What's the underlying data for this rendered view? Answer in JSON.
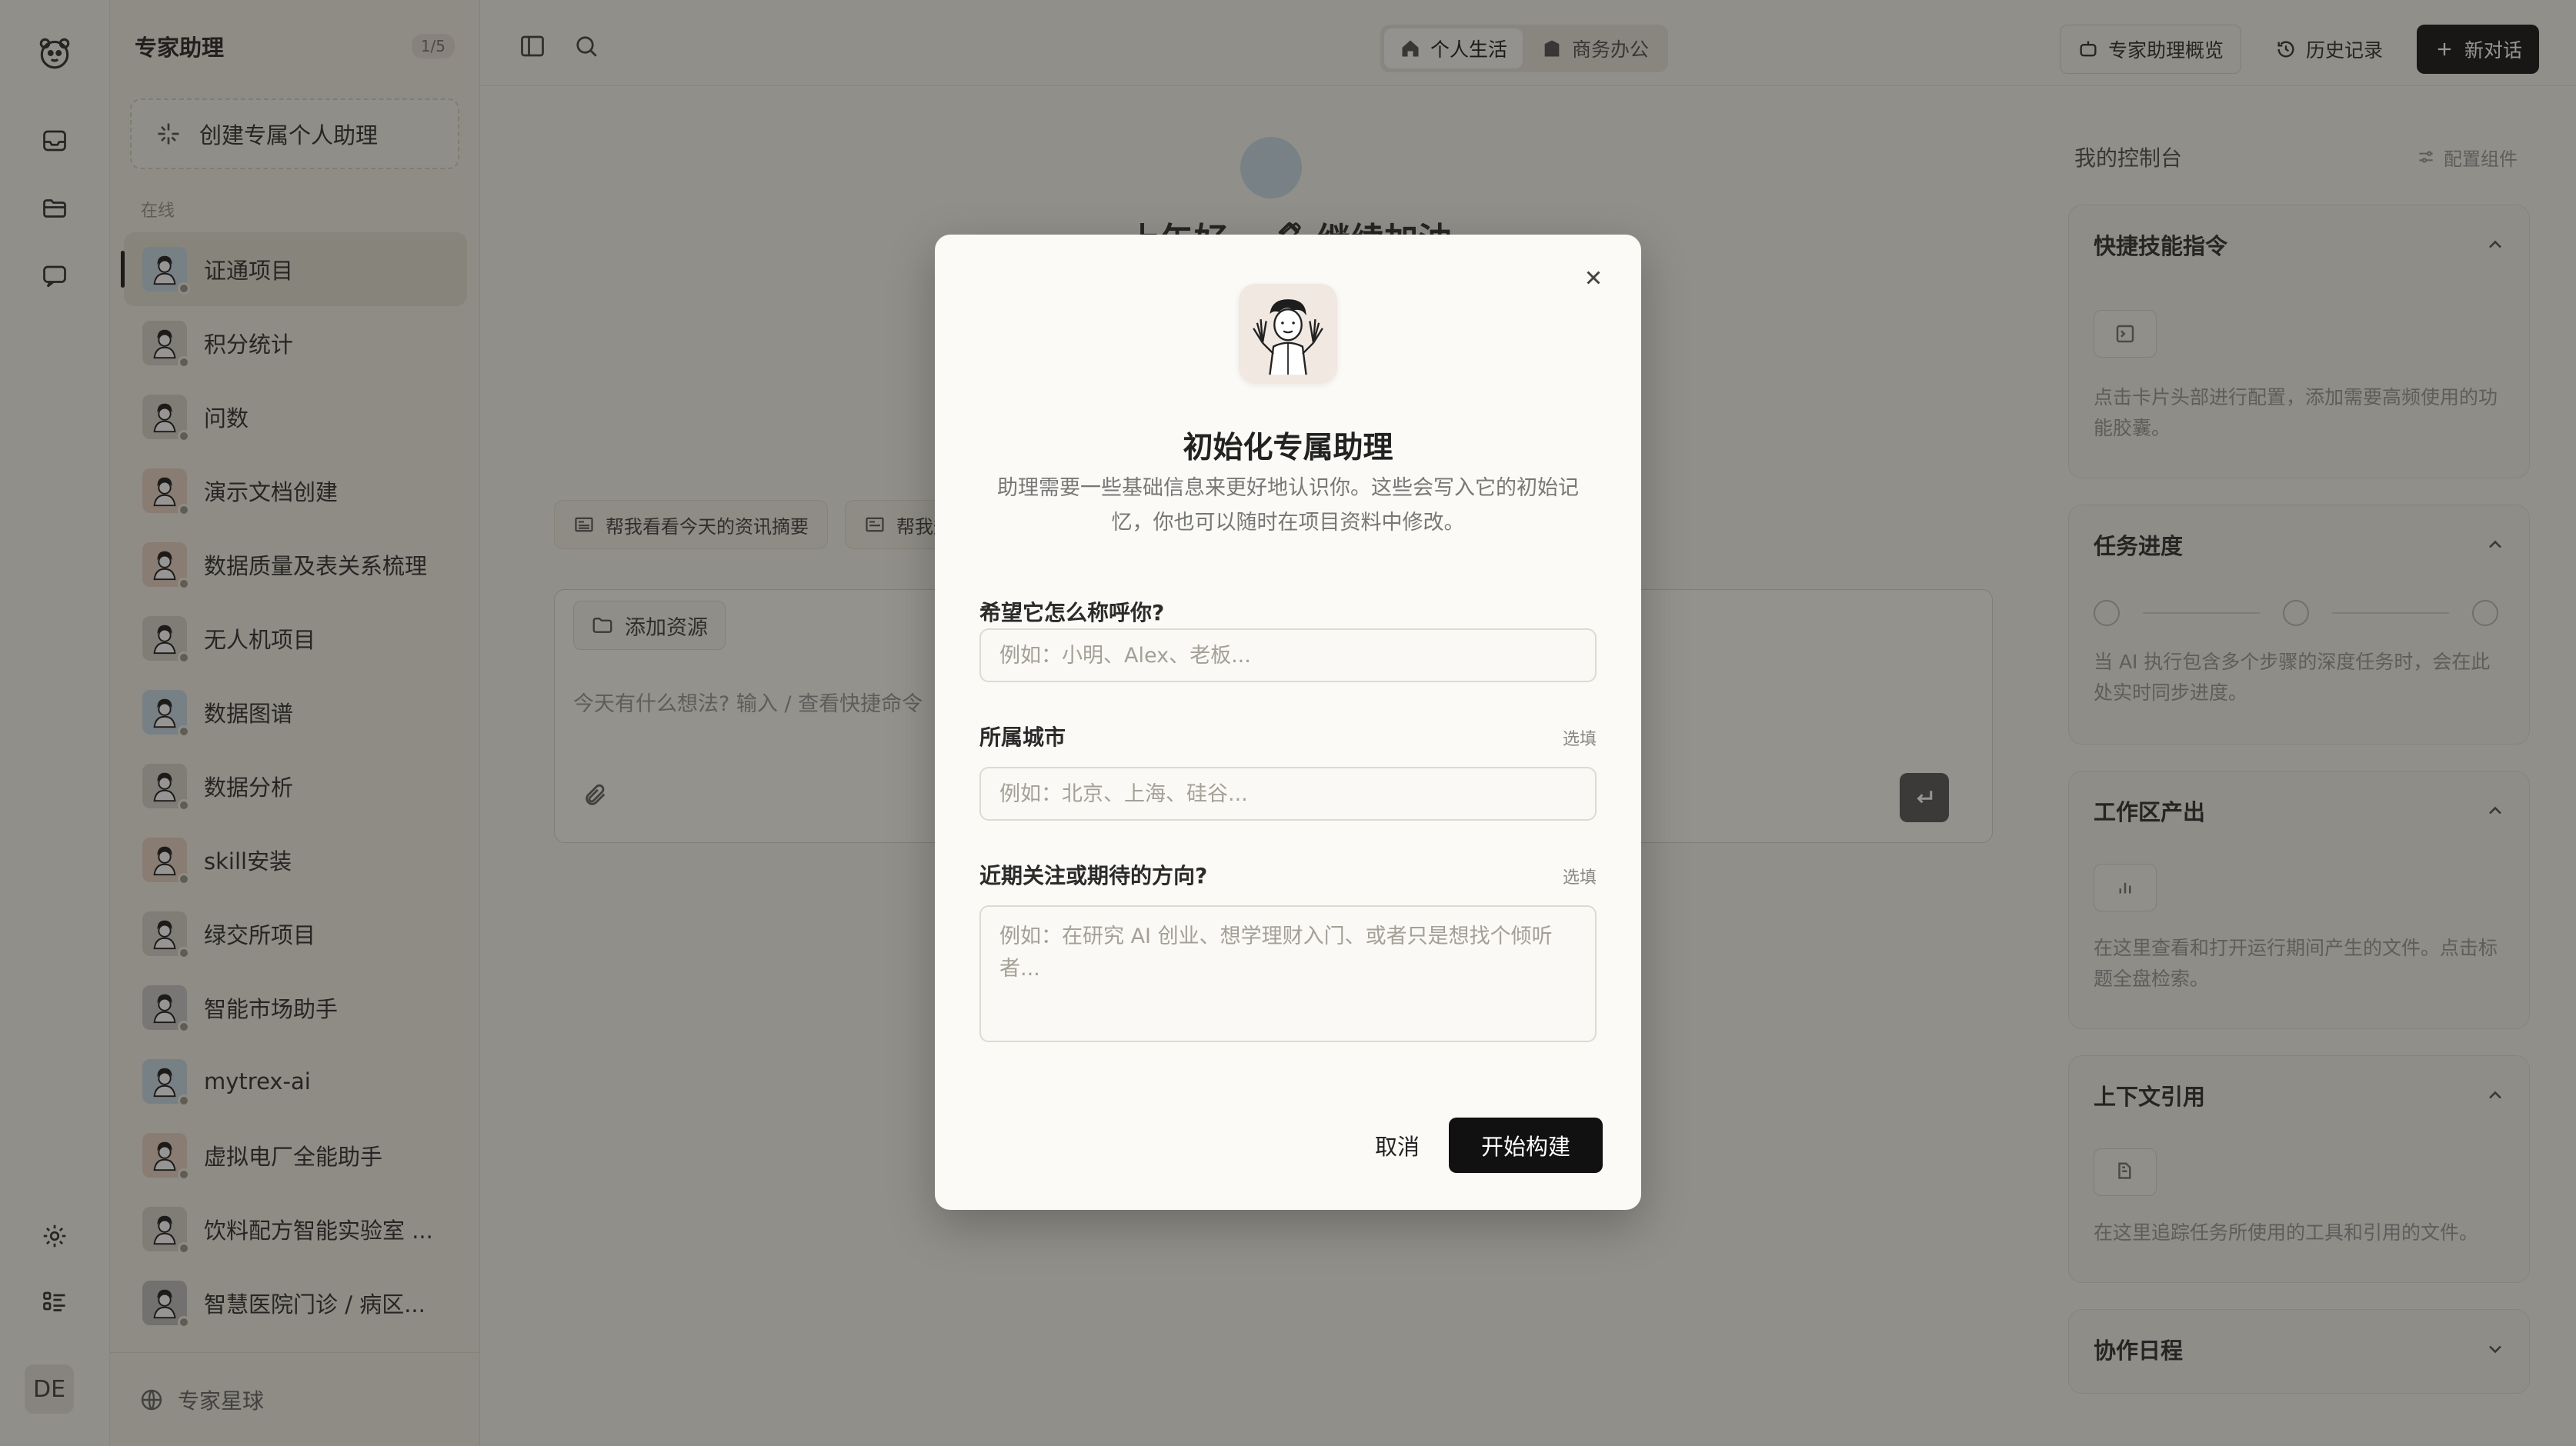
{
  "sidebar": {
    "title": "专家助理",
    "count": "1/5",
    "create_label": "创建专属个人助理",
    "section_label": "在线",
    "items": [
      {
        "label": "证通项目"
      },
      {
        "label": "积分统计"
      },
      {
        "label": "问数"
      },
      {
        "label": "演示文档创建"
      },
      {
        "label": "数据质量及表关系梳理"
      },
      {
        "label": "无人机项目"
      },
      {
        "label": "数据图谱"
      },
      {
        "label": "数据分析"
      },
      {
        "label": "skill安装"
      },
      {
        "label": "绿交所项目"
      },
      {
        "label": "智能市场助手"
      },
      {
        "label": "mytrex-ai"
      },
      {
        "label": "虚拟电厂全能助手"
      },
      {
        "label": "饮料配方智能实验室 ..."
      },
      {
        "label": "智慧医院门诊 / 病区..."
      }
    ],
    "footer_label": "专家星球"
  },
  "rail": {
    "avatar_initials": "DE"
  },
  "topbar": {
    "seg_personal": "个人生活",
    "seg_business": "商务办公",
    "overview_label": "专家助理概览",
    "history_label": "历史记录",
    "new_chat_label": "新对话"
  },
  "main": {
    "greeting": "上午好，🖋 继续加油",
    "chips": [
      "帮我看看今天的资讯摘要",
      "帮我规"
    ],
    "add_resource": "添加资源",
    "composer_placeholder": "今天有什么想法? 输入 / 查看快捷命令"
  },
  "panel": {
    "title": "我的控制台",
    "config_label": "配置组件",
    "cards": {
      "quick": {
        "title": "快捷技能指令",
        "desc": "点击卡片头部进行配置，添加需要高频使用的功能胶囊。"
      },
      "tasks": {
        "title": "任务进度",
        "desc": "当 AI 执行包含多个步骤的深度任务时，会在此处实时同步进度。"
      },
      "outputs": {
        "title": "工作区产出",
        "desc": "在这里查看和打开运行期间产生的文件。点击标题全盘检索。"
      },
      "context": {
        "title": "上下文引用",
        "desc": "在这里追踪任务所使用的工具和引用的文件。"
      },
      "schedule": {
        "title": "协作日程"
      }
    }
  },
  "modal": {
    "title": "初始化专属助理",
    "subtitle": "助理需要一些基础信息来更好地认识你。这些会写入它的初始记忆，你也可以随时在项目资料中修改。",
    "field_name": {
      "label": "希望它怎么称呼你?",
      "placeholder": "例如：小明、Alex、老板..."
    },
    "field_city": {
      "label": "所属城市",
      "optional": "选填",
      "placeholder": "例如：北京、上海、硅谷..."
    },
    "field_focus": {
      "label": "近期关注或期待的方向?",
      "optional": "选填",
      "placeholder": "例如：在研究 AI 创业、想学理财入门、或者只是想找个倾听者..."
    },
    "cancel_label": "取消",
    "start_label": "开始构建"
  },
  "colors": {
    "accent": "#111111",
    "background": "#f6f4ee",
    "overlay": "#16141073"
  }
}
